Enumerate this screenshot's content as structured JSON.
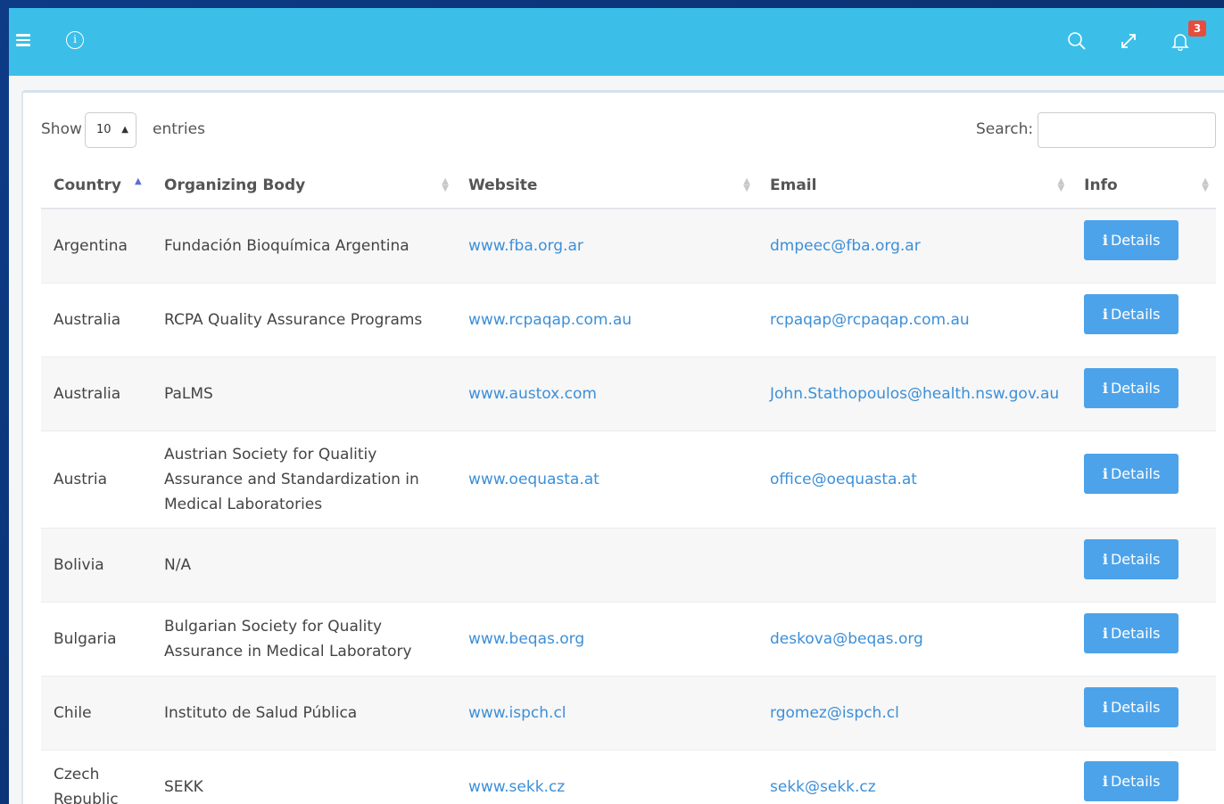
{
  "header": {
    "notifications_count": "3"
  },
  "controls": {
    "show_label": "Show",
    "entries_value": "10",
    "entries_label": "entries",
    "search_label": "Search:"
  },
  "table": {
    "columns": [
      "Country",
      "Organizing Body",
      "Website",
      "Email",
      "Info"
    ],
    "sorted_column": "Country",
    "sort_direction": "ascending",
    "button_label": "Details",
    "rows": [
      {
        "country": "Argentina",
        "body": "Fundación Bioquímica Argentina",
        "website": "www.fba.org.ar",
        "email": "dmpeec@fba.org.ar"
      },
      {
        "country": "Australia",
        "body": "RCPA Quality Assurance Programs",
        "website": "www.rcpaqap.com.au",
        "email": "rcpaqap@rcpaqap.com.au"
      },
      {
        "country": "Australia",
        "body": "PaLMS",
        "website": "www.austox.com",
        "email": "John.Stathopoulos@health.nsw.gov.au"
      },
      {
        "country": "Austria",
        "body": "Austrian Society for Qualitiy Assurance and Standardization in Medical Laboratories",
        "website": "www.oequasta.at",
        "email": "office@oequasta.at"
      },
      {
        "country": "Bolivia",
        "body": "N/A",
        "website": "",
        "email": ""
      },
      {
        "country": "Bulgaria",
        "body": "Bulgarian Society for Quality Assurance in Medical Laboratory",
        "website": "www.beqas.org",
        "email": "deskova@beqas.org"
      },
      {
        "country": "Chile",
        "body": "Instituto de Salud Pública",
        "website": "www.ispch.cl",
        "email": "rgomez@ispch.cl"
      },
      {
        "country": "Czech Republic",
        "body": "SEKK",
        "website": "www.sekk.cz",
        "email": "sekk@sekk.cz"
      }
    ]
  },
  "icons": [
    "menu-icon",
    "info-icon",
    "search-icon",
    "expand-icon",
    "bell-icon"
  ],
  "colors": {
    "header": "#3bbfe8",
    "button": "#4da3ea",
    "link": "#3c8fd8",
    "badge": "#e74c3c"
  }
}
